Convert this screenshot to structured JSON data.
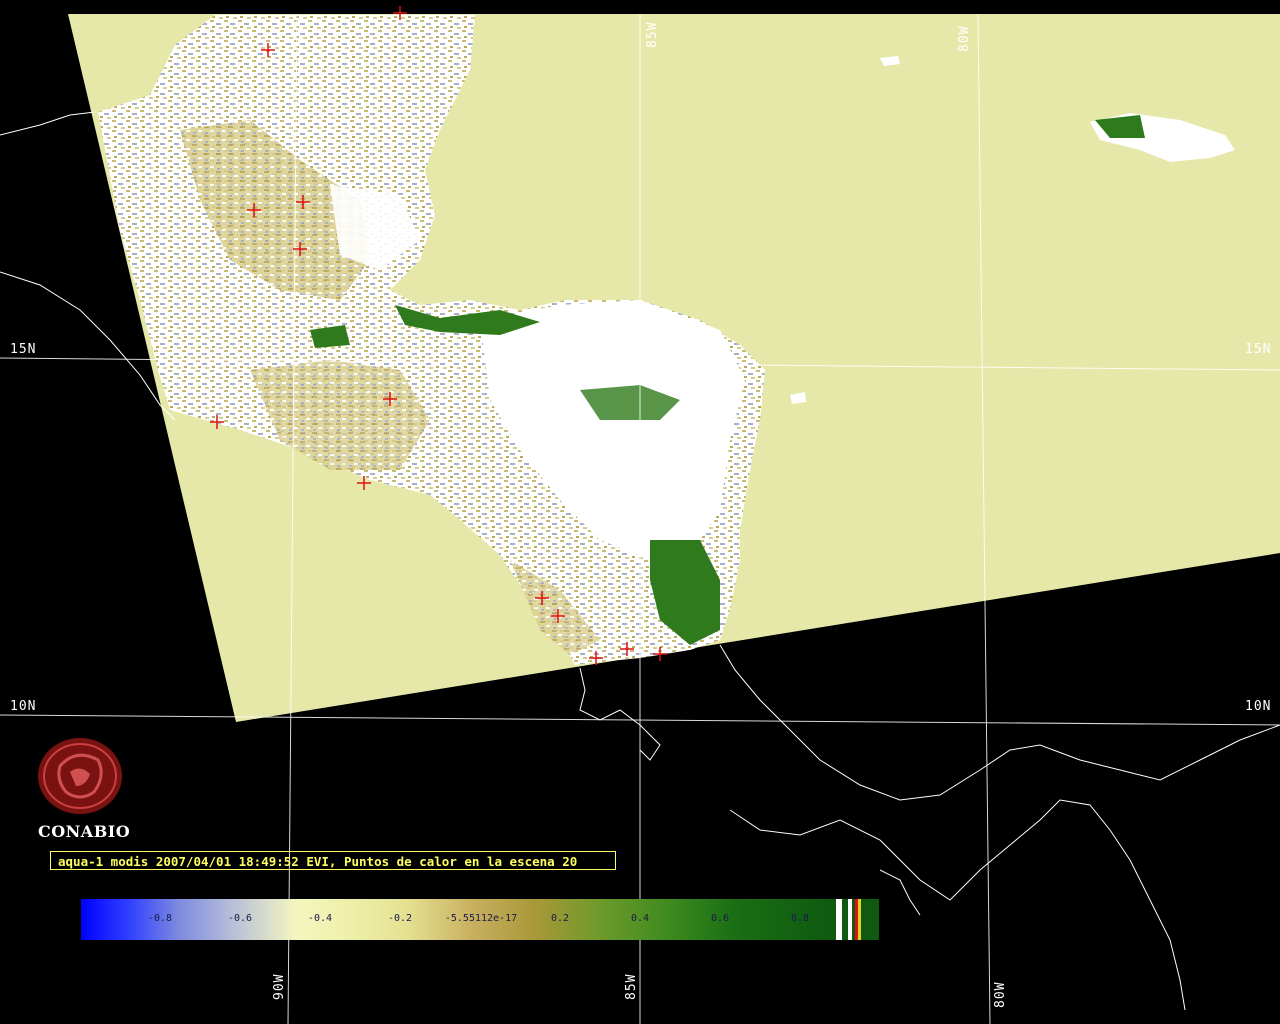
{
  "grid": {
    "lat_labels": [
      "15N",
      "10N"
    ],
    "lon_labels": [
      "85W",
      "80W",
      "90W"
    ]
  },
  "title": "aqua-1 modis 2007/04/01 18:49:52 EVI, Puntos de calor en la escena 20",
  "logo": {
    "text": "CONABIO",
    "icon": "conabio-logo"
  },
  "colorbar": {
    "ticks": [
      "-0.8",
      "-0.6",
      "-0.4",
      "-0.2",
      "-5.55112e-17",
      "0.2",
      "0.4",
      "0.6",
      "0.8"
    ]
  },
  "colors": {
    "ocean_fill": "#e6e8aa",
    "background": "#000000",
    "coastline": "#ffffff",
    "hotspot": "#e01010",
    "title_text": "#ffff60"
  },
  "legend_markers": [
    "hotspot-marker"
  ]
}
